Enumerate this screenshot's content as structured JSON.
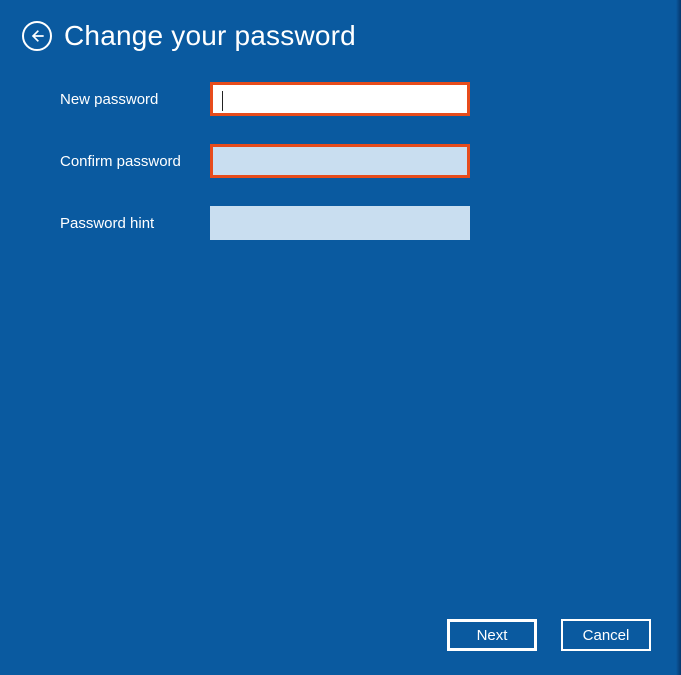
{
  "header": {
    "title": "Change your password"
  },
  "form": {
    "new_password": {
      "label": "New password",
      "value": ""
    },
    "confirm_password": {
      "label": "Confirm password",
      "value": ""
    },
    "password_hint": {
      "label": "Password hint",
      "value": ""
    }
  },
  "footer": {
    "next_label": "Next",
    "cancel_label": "Cancel"
  },
  "colors": {
    "background": "#0a5aa0",
    "highlight_border": "#e74c1c",
    "input_dim": "#c9def0"
  }
}
